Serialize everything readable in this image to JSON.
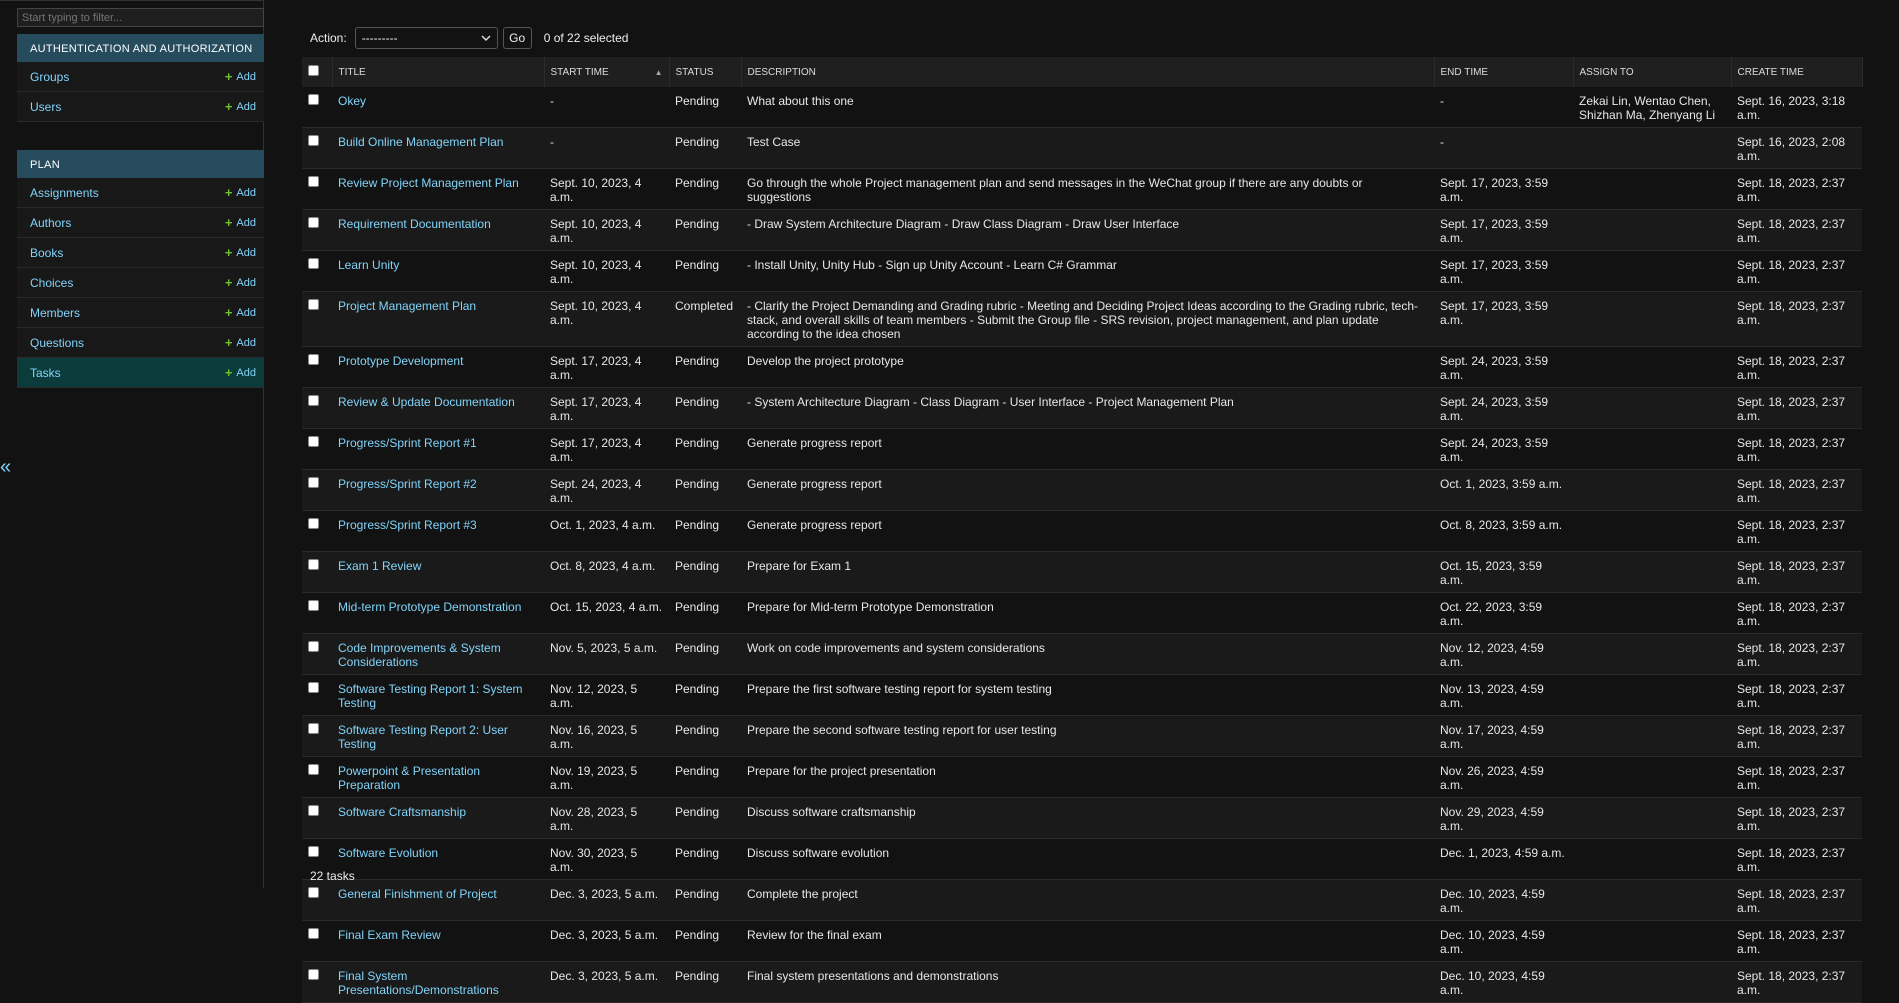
{
  "sidebar": {
    "filter_placeholder": "Start typing to filter...",
    "modules": [
      {
        "header": "Authentication and Authorization",
        "items": [
          {
            "label": "Groups",
            "add": "Add"
          },
          {
            "label": "Users",
            "add": "Add"
          }
        ]
      },
      {
        "header": "Plan",
        "items": [
          {
            "label": "Assignments",
            "add": "Add"
          },
          {
            "label": "Authors",
            "add": "Add"
          },
          {
            "label": "Books",
            "add": "Add"
          },
          {
            "label": "Choices",
            "add": "Add"
          },
          {
            "label": "Members",
            "add": "Add"
          },
          {
            "label": "Questions",
            "add": "Add"
          },
          {
            "label": "Tasks",
            "add": "Add",
            "current": true
          }
        ]
      }
    ],
    "collapse_glyph": "«"
  },
  "actions": {
    "label": "Action:",
    "selected_value": "---------",
    "go_label": "Go",
    "counter": "0 of 22 selected"
  },
  "columns": [
    "Title",
    "Start time",
    "Status",
    "Description",
    "End time",
    "Assign to",
    "Create time"
  ],
  "rows": [
    {
      "title": "Okey",
      "start": "-",
      "status": "Pending",
      "desc": "What about this one",
      "end": "-",
      "assign": "Zekai Lin, Wentao Chen, Shizhan Ma, Zhenyang Li",
      "create": "Sept. 16, 2023, 3:18 a.m."
    },
    {
      "title": "Build Online Management Plan",
      "start": "-",
      "status": "Pending",
      "desc": "Test Case",
      "end": "-",
      "assign": "",
      "create": "Sept. 16, 2023, 2:08 a.m."
    },
    {
      "title": "Review Project Management Plan",
      "start": "Sept. 10, 2023, 4 a.m.",
      "status": "Pending",
      "desc": "Go through the whole Project management plan and send messages in the WeChat group if there are any doubts or suggestions",
      "end": "Sept. 17, 2023, 3:59 a.m.",
      "assign": "",
      "create": "Sept. 18, 2023, 2:37 a.m."
    },
    {
      "title": "Requirement Documentation",
      "start": "Sept. 10, 2023, 4 a.m.",
      "status": "Pending",
      "desc": "- Draw System Architecture Diagram - Draw Class Diagram - Draw User Interface",
      "end": "Sept. 17, 2023, 3:59 a.m.",
      "assign": "",
      "create": "Sept. 18, 2023, 2:37 a.m."
    },
    {
      "title": "Learn Unity",
      "start": "Sept. 10, 2023, 4 a.m.",
      "status": "Pending",
      "desc": "- Install Unity, Unity Hub - Sign up Unity Account - Learn C# Grammar",
      "end": "Sept. 17, 2023, 3:59 a.m.",
      "assign": "",
      "create": "Sept. 18, 2023, 2:37 a.m."
    },
    {
      "title": "Project Management Plan",
      "start": "Sept. 10, 2023, 4 a.m.",
      "status": "Completed",
      "desc": "- Clarify the Project Demanding and Grading rubric - Meeting and Deciding Project Ideas according to the Grading rubric, tech-stack, and overall skills of team members - Submit the Group file - SRS revision, project management, and plan update according to the idea chosen",
      "end": "Sept. 17, 2023, 3:59 a.m.",
      "assign": "",
      "create": "Sept. 18, 2023, 2:37 a.m."
    },
    {
      "title": "Prototype Development",
      "start": "Sept. 17, 2023, 4 a.m.",
      "status": "Pending",
      "desc": "Develop the project prototype",
      "end": "Sept. 24, 2023, 3:59 a.m.",
      "assign": "",
      "create": "Sept. 18, 2023, 2:37 a.m."
    },
    {
      "title": "Review & Update Documentation",
      "start": "Sept. 17, 2023, 4 a.m.",
      "status": "Pending",
      "desc": "- System Architecture Diagram - Class Diagram - User Interface - Project Management Plan",
      "end": "Sept. 24, 2023, 3:59 a.m.",
      "assign": "",
      "create": "Sept. 18, 2023, 2:37 a.m."
    },
    {
      "title": "Progress/Sprint Report #1",
      "start": "Sept. 17, 2023, 4 a.m.",
      "status": "Pending",
      "desc": "Generate progress report",
      "end": "Sept. 24, 2023, 3:59 a.m.",
      "assign": "",
      "create": "Sept. 18, 2023, 2:37 a.m."
    },
    {
      "title": "Progress/Sprint Report #2",
      "start": "Sept. 24, 2023, 4 a.m.",
      "status": "Pending",
      "desc": "Generate progress report",
      "end": "Oct. 1, 2023, 3:59 a.m.",
      "assign": "",
      "create": "Sept. 18, 2023, 2:37 a.m."
    },
    {
      "title": "Progress/Sprint Report #3",
      "start": "Oct. 1, 2023, 4 a.m.",
      "status": "Pending",
      "desc": "Generate progress report",
      "end": "Oct. 8, 2023, 3:59 a.m.",
      "assign": "",
      "create": "Sept. 18, 2023, 2:37 a.m."
    },
    {
      "title": "Exam 1 Review",
      "start": "Oct. 8, 2023, 4 a.m.",
      "status": "Pending",
      "desc": "Prepare for Exam 1",
      "end": "Oct. 15, 2023, 3:59 a.m.",
      "assign": "",
      "create": "Sept. 18, 2023, 2:37 a.m."
    },
    {
      "title": "Mid-term Prototype Demonstration",
      "start": "Oct. 15, 2023, 4 a.m.",
      "status": "Pending",
      "desc": "Prepare for Mid-term Prototype Demonstration",
      "end": "Oct. 22, 2023, 3:59 a.m.",
      "assign": "",
      "create": "Sept. 18, 2023, 2:37 a.m."
    },
    {
      "title": "Code Improvements & System Considerations",
      "start": "Nov. 5, 2023, 5 a.m.",
      "status": "Pending",
      "desc": "Work on code improvements and system considerations",
      "end": "Nov. 12, 2023, 4:59 a.m.",
      "assign": "",
      "create": "Sept. 18, 2023, 2:37 a.m."
    },
    {
      "title": "Software Testing Report 1: System Testing",
      "start": "Nov. 12, 2023, 5 a.m.",
      "status": "Pending",
      "desc": "Prepare the first software testing report for system testing",
      "end": "Nov. 13, 2023, 4:59 a.m.",
      "assign": "",
      "create": "Sept. 18, 2023, 2:37 a.m."
    },
    {
      "title": "Software Testing Report 2: User Testing",
      "start": "Nov. 16, 2023, 5 a.m.",
      "status": "Pending",
      "desc": "Prepare the second software testing report for user testing",
      "end": "Nov. 17, 2023, 4:59 a.m.",
      "assign": "",
      "create": "Sept. 18, 2023, 2:37 a.m."
    },
    {
      "title": "Powerpoint & Presentation Preparation",
      "start": "Nov. 19, 2023, 5 a.m.",
      "status": "Pending",
      "desc": "Prepare for the project presentation",
      "end": "Nov. 26, 2023, 4:59 a.m.",
      "assign": "",
      "create": "Sept. 18, 2023, 2:37 a.m."
    },
    {
      "title": "Software Craftsmanship",
      "start": "Nov. 28, 2023, 5 a.m.",
      "status": "Pending",
      "desc": "Discuss software craftsmanship",
      "end": "Nov. 29, 2023, 4:59 a.m.",
      "assign": "",
      "create": "Sept. 18, 2023, 2:37 a.m."
    },
    {
      "title": "Software Evolution",
      "start": "Nov. 30, 2023, 5 a.m.",
      "status": "Pending",
      "desc": "Discuss software evolution",
      "end": "Dec. 1, 2023, 4:59 a.m.",
      "assign": "",
      "create": "Sept. 18, 2023, 2:37 a.m."
    },
    {
      "title": "General Finishment of Project",
      "start": "Dec. 3, 2023, 5 a.m.",
      "status": "Pending",
      "desc": "Complete the project",
      "end": "Dec. 10, 2023, 4:59 a.m.",
      "assign": "",
      "create": "Sept. 18, 2023, 2:37 a.m."
    },
    {
      "title": "Final Exam Review",
      "start": "Dec. 3, 2023, 5 a.m.",
      "status": "Pending",
      "desc": "Review for the final exam",
      "end": "Dec. 10, 2023, 4:59 a.m.",
      "assign": "",
      "create": "Sept. 18, 2023, 2:37 a.m."
    },
    {
      "title": "Final System Presentations/Demonstrations",
      "start": "Dec. 3, 2023, 5 a.m.",
      "status": "Pending",
      "desc": "Final system presentations and demonstrations",
      "end": "Dec. 10, 2023, 4:59 a.m.",
      "assign": "",
      "create": "Sept. 18, 2023, 2:37 a.m."
    }
  ],
  "footer": {
    "count": "22 tasks"
  }
}
